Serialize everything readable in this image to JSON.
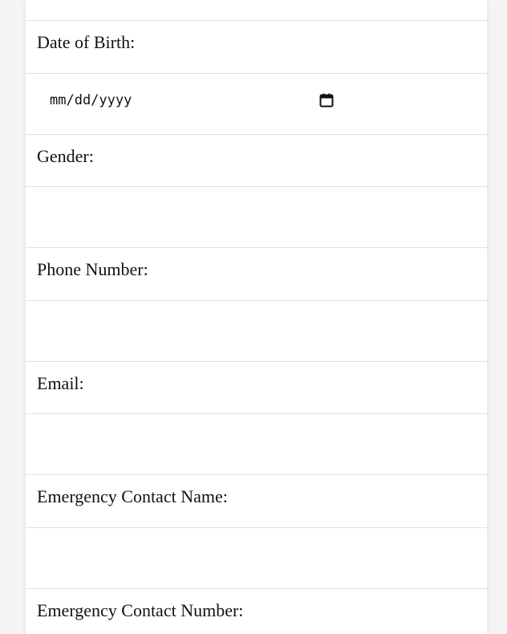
{
  "form": {
    "date_of_birth": {
      "label": "Date of Birth:",
      "placeholder": "mm/dd/yyyy",
      "value": ""
    },
    "gender": {
      "label": "Gender:",
      "value": ""
    },
    "phone": {
      "label": "Phone Number:",
      "value": ""
    },
    "email": {
      "label": "Email:",
      "value": ""
    },
    "emergency_name": {
      "label": "Emergency Contact Name:",
      "value": ""
    },
    "emergency_number": {
      "label": "Emergency Contact Number:",
      "value": ""
    }
  },
  "icons": {
    "calendar": "calendar-icon"
  }
}
